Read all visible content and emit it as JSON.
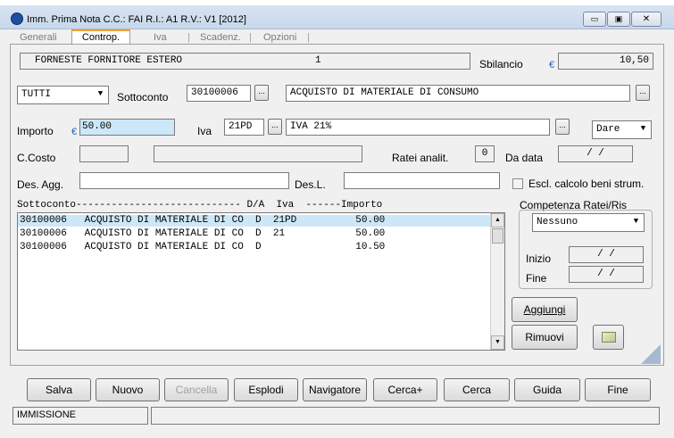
{
  "window": {
    "title": "Imm. Prima Nota C.C.: FAI  R.I.: A1  R.V.: V1  [2012]",
    "minimize": "▭",
    "maximize": "▣",
    "close": "✕"
  },
  "tabs": [
    {
      "label": "Generali"
    },
    {
      "label": "Controp."
    },
    {
      "label": "Iva"
    },
    {
      "label": "Scadenz."
    },
    {
      "label": "Opzioni"
    }
  ],
  "header": {
    "supplier": "FORNESTE FORNITORE ESTERO",
    "number": "1",
    "sbilancio_label": "Sbilancio",
    "euro": "€",
    "sbilancio_value": "10,50"
  },
  "form": {
    "filter": "TUTTI",
    "sottoconto_label": "Sottoconto",
    "sottoconto_code": "30100006",
    "sottoconto_desc": "ACQUISTO DI MATERIALE DI CONSUMO",
    "importo_label": "Importo",
    "importo_value": "50.00",
    "iva_label": "Iva",
    "iva_code": "21PD",
    "iva_desc": "IVA 21%",
    "dare_avere": "Dare",
    "ccosto_label": "C.Costo",
    "ratei_label": "Ratei analit.",
    "ratei_value": "0",
    "da_data_label": "Da data",
    "da_data_value": "/  /",
    "des_agg_label": "Des. Agg.",
    "des_l_label": "Des.L.",
    "escl_label": "Escl. calcolo beni strum.",
    "ellipsis": "..."
  },
  "list": {
    "header": "Sottoconto---------------------------- D/A  Iva  ------Importo",
    "rows": [
      {
        "text": "30100006   ACQUISTO DI MATERIALE DI CO  D  21PD          50.00"
      },
      {
        "text": "30100006   ACQUISTO DI MATERIALE DI CO  D  21            50.00"
      },
      {
        "text": "30100006   ACQUISTO DI MATERIALE DI CO  D                10.50"
      }
    ]
  },
  "competenza": {
    "title": "Competenza Ratei/Ris",
    "value": "Nessuno",
    "inizio_label": "Inizio",
    "inizio_value": "/  /",
    "fine_label": "Fine",
    "fine_value": "/  /"
  },
  "side_buttons": {
    "aggiungi": "Aggiungi",
    "rimuovi": "Rimuovi"
  },
  "buttons": {
    "salva": "Salva",
    "nuovo": "Nuovo",
    "cancella": "Cancella",
    "esplodi": "Esplodi",
    "navigatore": "Navigatore",
    "cerca_plus": "Cerca+",
    "cerca": "Cerca",
    "guida": "Guida",
    "fine": "Fine"
  },
  "status": {
    "mode": "IMMISSIONE"
  }
}
